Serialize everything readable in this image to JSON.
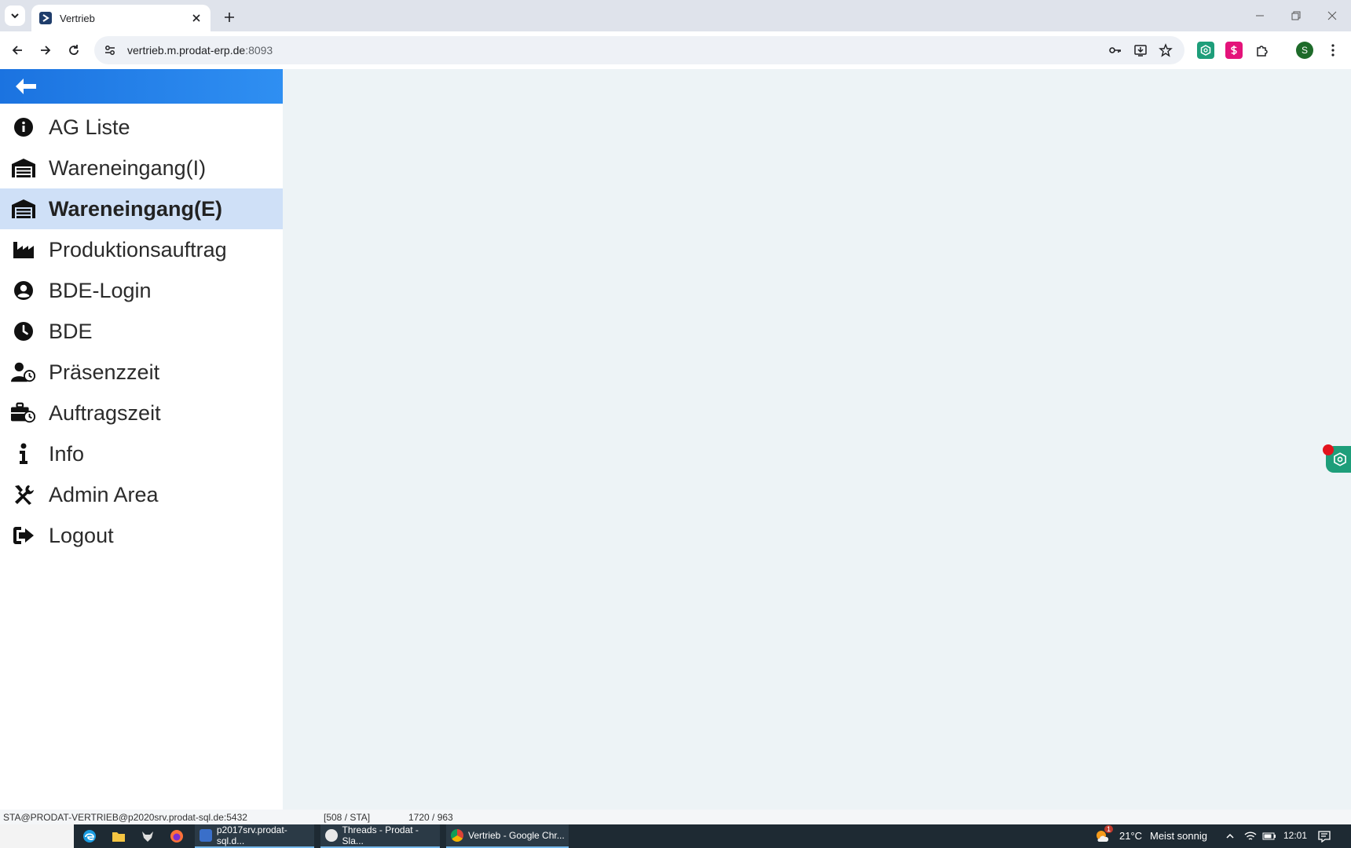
{
  "browser": {
    "tab_title": "Vertrieb",
    "url_host": "vertrieb.m.prodat-erp.de",
    "url_port": ":8093",
    "profile_initial": "S"
  },
  "sidebar": {
    "items": [
      {
        "label": "AG Liste",
        "icon": "info-circle-icon",
        "active": false
      },
      {
        "label": "Wareneingang(I)",
        "icon": "warehouse-icon",
        "active": false
      },
      {
        "label": "Wareneingang(E)",
        "icon": "warehouse-icon",
        "active": true
      },
      {
        "label": "Produktionsauftrag",
        "icon": "industry-icon",
        "active": false
      },
      {
        "label": "BDE-Login",
        "icon": "user-circle-icon",
        "active": false
      },
      {
        "label": "BDE",
        "icon": "clock-icon",
        "active": false
      },
      {
        "label": "Präsenzzeit",
        "icon": "user-clock-icon",
        "active": false
      },
      {
        "label": "Auftragszeit",
        "icon": "briefcase-clock-icon",
        "active": false
      },
      {
        "label": "Info",
        "icon": "info-icon",
        "active": false
      },
      {
        "label": "Admin Area",
        "icon": "tools-icon",
        "active": false
      },
      {
        "label": "Logout",
        "icon": "sign-out-icon",
        "active": false
      }
    ]
  },
  "status": {
    "connection": "STA@PRODAT-VERTRIEB@p2020srv.prodat-sql.de:5432",
    "user": "[508 / STA]",
    "resolution": "1720 / 963"
  },
  "taskbar": {
    "apps": [
      "p2017srv.prodat-sql.d...",
      "Threads - Prodat - Sla...",
      "Vertrieb - Google Chr..."
    ],
    "weather_badge": "1",
    "temperature": "21°C",
    "weather": "Meist sonnig",
    "time": "12:01"
  },
  "colors": {
    "header_gradient_start": "#1b73e0",
    "header_gradient_end": "#2f8ff2",
    "active_item_bg": "#cfe0f7",
    "content_bg": "#edf3f6"
  }
}
